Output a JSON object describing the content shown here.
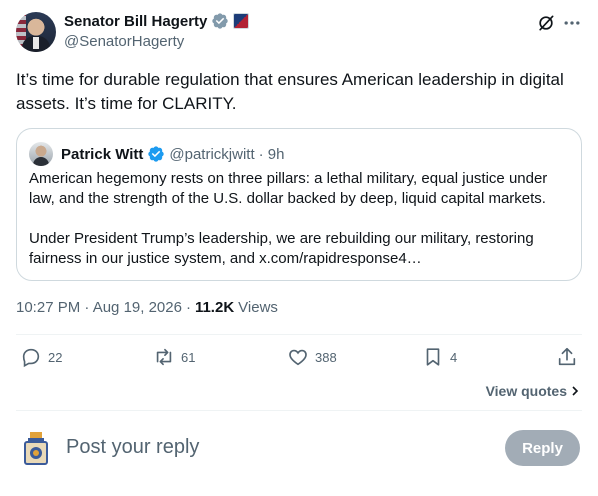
{
  "author": {
    "display_name": "Senator Bill Hagerty",
    "handle": "@SenatorHagerty"
  },
  "tweet": {
    "text": "It’s time for durable regulation that ensures American leadership in digital assets. It’s time for CLARITY.",
    "timestamp": "10:27 PM · Aug 19, 2026",
    "views_count": "11.2K",
    "views_label": "Views"
  },
  "quoted_post": {
    "display_name": "Patrick Witt",
    "handle": "@patrickjwitt",
    "time": "· 9h",
    "paragraph_1": "American hegemony rests on three pillars: a lethal military, equal justice under law, and the strength of the U.S. dollar backed by deep, liquid capital markets.",
    "paragraph_2": "Under President Trump’s leadership, we are rebuilding our military, restoring fairness in our justice system, and x.com/rapidresponse4…"
  },
  "actions": {
    "replies": "22",
    "reposts": "61",
    "likes": "388",
    "bookmarks": "4"
  },
  "view_quotes_label": "View quotes",
  "reply": {
    "placeholder": "Post your reply",
    "button_label": "Reply"
  },
  "colors": {
    "verified_badge": "#1d9bf0",
    "secondary_text": "#536471",
    "primary_text": "#0f1419",
    "border": "#cfd9de"
  },
  "icons": {
    "verified": "verified-badge-icon",
    "grok": "grok-icon",
    "more": "more-icon",
    "reply": "reply-icon",
    "repost": "repost-icon",
    "like": "like-icon",
    "bookmark": "bookmark-icon",
    "share": "share-icon",
    "chevron": "chevron-right-icon"
  }
}
